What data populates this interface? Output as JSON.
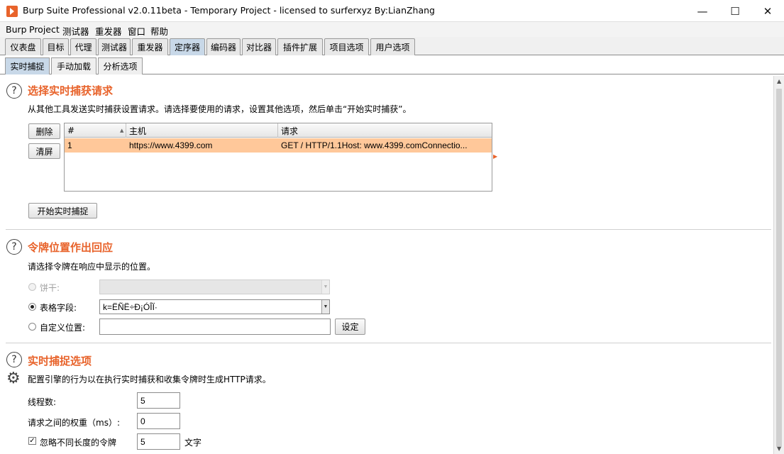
{
  "window": {
    "title": "Burp Suite Professional v2.0.11beta - Temporary Project - licensed to surferxyz By:LianZhang",
    "minimize_glyph": "—",
    "maximize_glyph": "☐",
    "close_glyph": "✕"
  },
  "menu": [
    "Burp",
    "Project",
    "测试器",
    "重发器",
    "窗口",
    "帮助"
  ],
  "tabs": [
    "仪表盘",
    "目标",
    "代理",
    "测试器",
    "重发器",
    "定序器",
    "编码器",
    "对比器",
    "插件扩展",
    "项目选项",
    "用户选项"
  ],
  "active_tab": "定序器",
  "subtabs": [
    "实时捕捉",
    "手动加载",
    "分析选项"
  ],
  "active_subtab": "实时捕捉",
  "section1": {
    "title": "选择实时捕获请求",
    "description": "从其他工具发送实时捕获设置请求。请选择要使用的请求，设置其他选项，然后单击“开始实时捕获”。",
    "remove_button": "删除",
    "clear_button": "清屏",
    "table": {
      "columns": [
        "#",
        "主机",
        "请求"
      ],
      "rows": [
        {
          "num": "1",
          "host": "https://www.4399.com",
          "request": "GET / HTTP/1.1Host: www.4399.comConnectio..."
        }
      ]
    },
    "start_button": "开始实时捕捉"
  },
  "section2": {
    "title": "令牌位置作出回应",
    "description": "请选择令牌在响应中显示的位置。",
    "cookie_label": "饼干:",
    "form_field_label": "表格字段:",
    "form_field_value": "k=ËÑË÷Ð¡ÓÎÏ·",
    "custom_location_label": "自定义位置:",
    "custom_location_value": "",
    "config_button": "设定",
    "selected_option": "form_field"
  },
  "section3": {
    "title": "实时捕捉选项",
    "description": "配置引擎的行为以在执行实时捕获和收集令牌时生成HTTP请求。",
    "threads_label": "线程数:",
    "threads_value": "5",
    "throttle_label": "请求之间的权重（ms）:",
    "throttle_value": "0",
    "ignore_label": "忽略不同长度的令牌",
    "ignore_checked": true,
    "ignore_value": "5",
    "ignore_unit": "文字"
  },
  "icons": {
    "help": "help-icon",
    "gear": "gear-icon",
    "sort": "sort-ascending-icon"
  },
  "colors": {
    "accent": "#e8632b",
    "selected_row": "#ffc89a",
    "active_tab": "#c8d8e8"
  }
}
